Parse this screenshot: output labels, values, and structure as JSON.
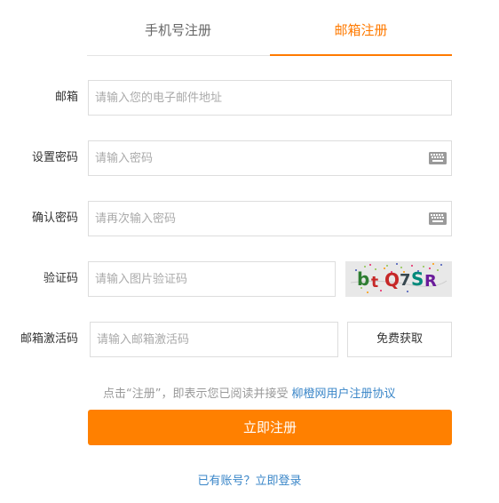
{
  "tabs": {
    "phone": "手机号注册",
    "email": "邮箱注册",
    "active": "email"
  },
  "form": {
    "email": {
      "label": "邮箱",
      "placeholder": "请输入您的电子邮件地址",
      "value": ""
    },
    "password": {
      "label": "设置密码",
      "placeholder": "请输入密码",
      "value": "",
      "icon": "keyboard-icon"
    },
    "confirm": {
      "label": "确认密码",
      "placeholder": "请再次输入密码",
      "value": "",
      "icon": "keyboard-icon"
    },
    "captcha": {
      "label": "验证码",
      "placeholder": "请输入图片验证码",
      "value": "",
      "image_text": "btQ7SR"
    },
    "activation": {
      "label": "邮箱激活码",
      "placeholder": "请输入邮箱激活码",
      "value": "",
      "button": "免费获取"
    }
  },
  "agreement": {
    "text": "点击“注册”，即表示您已阅读并接受",
    "link": "柳橙网用户注册协议"
  },
  "submit": "立即注册",
  "login_link": "已有账号？立即登录",
  "colors": {
    "accent": "#ff8000",
    "link": "#3a86c8",
    "border": "#dddddd"
  }
}
